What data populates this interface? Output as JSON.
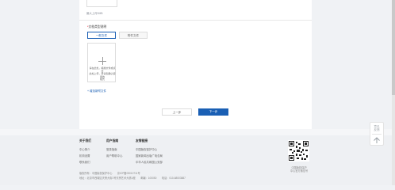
{
  "form": {
    "prev_field_note": "最大上传3MB",
    "section_title": "文档类型说明",
    "required_mark": "*",
    "tabs": [
      {
        "label": "一般文件",
        "active": true
      },
      {
        "label": "附件文件",
        "active": false
      }
    ],
    "upload_hint": "请在此处，拖拽文件或点击\n此处上传，并请您确认使用的\n格式",
    "add_link": "+ 增加新附文件"
  },
  "nav_buttons": {
    "prev": "上一步",
    "next": "下一步"
  },
  "footer": {
    "columns": [
      {
        "title": "关于我们",
        "links": [
          "中心简介",
          "机构设置",
          "联系我们"
        ]
      },
      {
        "title": "用户指南",
        "links": [
          "登录指南",
          "用户帮助中心"
        ]
      },
      {
        "title": "友情链接",
        "links": [
          "中国版权保护中心",
          "国家新闻出版广电总局",
          "中华人民共和国公安部"
        ]
      }
    ],
    "copyright": "版权所有：中国版权保护中心　　京ICP备05010711号",
    "address": "地址：北京市西城区天桥大街1号天桥艺术大厦A座　　邮编：100050　　电话：010-68003887",
    "qr_caption": "中国版权保护\n中心官方微信号"
  },
  "float_panel": {
    "label": "意见\n反馈",
    "icon": "arrow-up-icon"
  }
}
